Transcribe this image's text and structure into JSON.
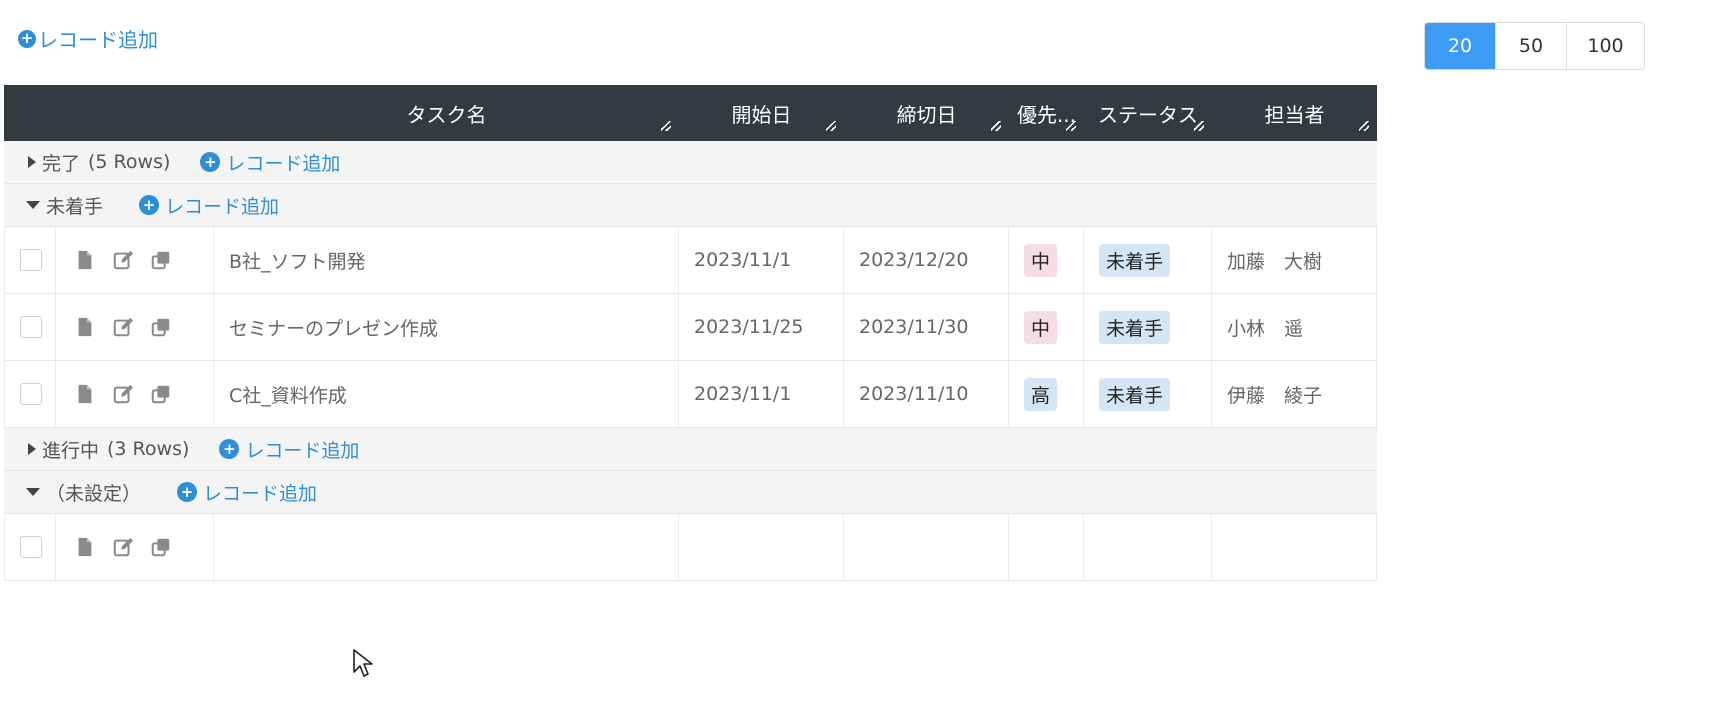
{
  "toolbar": {
    "add_label": "レコード追加"
  },
  "pagination": {
    "options": [
      "20",
      "50",
      "100"
    ],
    "selected": "20"
  },
  "columns": [
    "タスク名",
    "開始日",
    "締切日",
    "優先...",
    "ステータス",
    "担当者"
  ],
  "groups": [
    {
      "label": "完了",
      "count": "(5 Rows)",
      "expanded": false,
      "add_label": "レコード追加"
    },
    {
      "label": "未着手",
      "count": "",
      "expanded": true,
      "add_label": "レコード追加"
    },
    {
      "label": "進行中",
      "count": "(3 Rows)",
      "expanded": false,
      "add_label": "レコード追加"
    },
    {
      "label": "（未設定）",
      "count": "",
      "expanded": true,
      "add_label": "レコード追加"
    }
  ],
  "rows": [
    {
      "task": "B社_ソフト開発",
      "start": "2023/11/1",
      "due": "2023/12/20",
      "priority": "中",
      "status": "未着手",
      "assignee": "加藤　大樹"
    },
    {
      "task": "セミナーのプレゼン作成",
      "start": "2023/11/25",
      "due": "2023/11/30",
      "priority": "中",
      "status": "未着手",
      "assignee": "小林　遥"
    },
    {
      "task": "C社_資料作成",
      "start": "2023/11/1",
      "due": "2023/11/10",
      "priority": "高",
      "status": "未着手",
      "assignee": "伊藤　綾子"
    }
  ],
  "colors": {
    "accent": "#2e8fd6",
    "header_bg": "#343a40",
    "pager_active": "#3d9bf5",
    "priority_mid_bg": "#f6dde4",
    "priority_high_bg": "#d4e6f5",
    "status_bg": "#d4e6f5"
  },
  "icons": [
    "plus-circle-icon",
    "file-icon",
    "edit-icon",
    "copy-icon",
    "caret-right-icon",
    "caret-down-icon",
    "resize-handle-icon",
    "mouse-cursor-icon"
  ]
}
